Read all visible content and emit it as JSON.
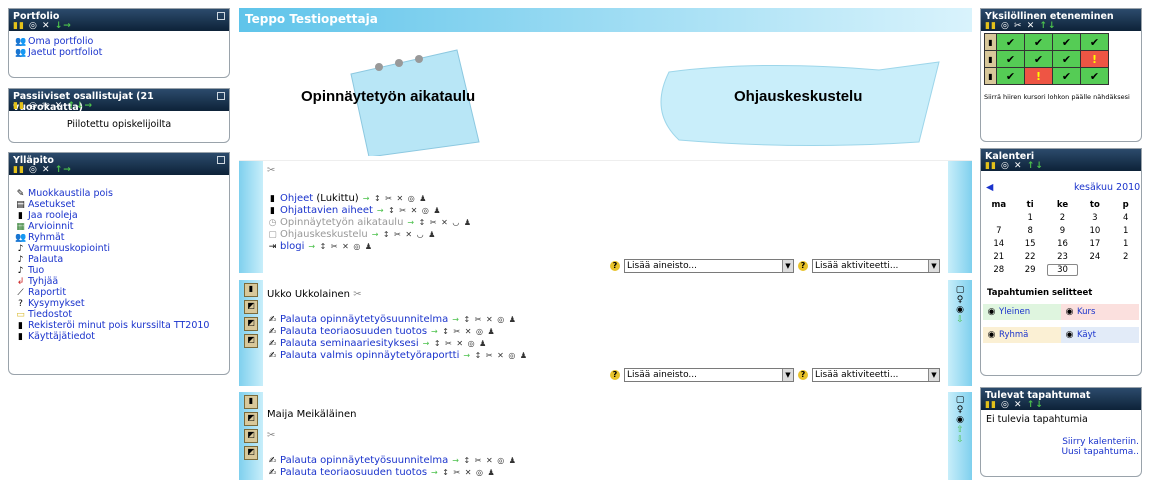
{
  "portfolio": {
    "title": "Portfolio",
    "items": [
      "Oma portfolio",
      "Jaetut portfoliot"
    ]
  },
  "passive": {
    "title": "Passiiviset osallistujat (21 vuorokautta)",
    "text": "Piilotettu opiskelijoilta"
  },
  "admin": {
    "title": "Ylläpito",
    "items": [
      "Muokkaustila pois",
      "Asetukset",
      "Jaa rooleja",
      "Arvioinnit",
      "Ryhmät",
      "Varmuuskopiointi",
      "Palauta",
      "Tuo",
      "Tyhjää",
      "Raportit",
      "Kysymykset",
      "Tiedostot",
      "Rekisteröi minut pois kurssilta TT2010",
      "Käyttäjätiedot"
    ]
  },
  "center": {
    "heading": "Teppo Testiopettaja",
    "banner_left": "Opinnäytetyön aikataulu",
    "banner_right": "Ohjauskeskustelu",
    "section0": {
      "activities": [
        {
          "label": "Ohjeet",
          "suffix": "(Lukittu)"
        },
        {
          "label": "Ohjattavien aiheet",
          "suffix": ""
        },
        {
          "label": "Opinnäytetyön aikataulu",
          "suffix": ""
        },
        {
          "label": "Ohjauskeskustelu",
          "suffix": ""
        },
        {
          "label": "blogi",
          "suffix": ""
        }
      ]
    },
    "section1": {
      "title": "Ukko Ukkolainen",
      "activities": [
        "Palauta opinnäytetyösuunnitelma",
        "Palauta teoriaosuuden tuotos",
        "Palauta seminaariesityksesi",
        "Palauta valmis opinnäytetyöraportti"
      ]
    },
    "section2": {
      "title": "Maija Meikäläinen",
      "activities": [
        "Palauta opinnäytetyösuunnitelma",
        "Palauta teoriaosuuden tuotos"
      ]
    },
    "add_resource": "Lisää aineisto...",
    "add_activity": "Lisää aktiviteetti..."
  },
  "progress": {
    "title": "Yksilöllinen eteneminen",
    "rows": [
      [
        "ok",
        "ok",
        "ok",
        "ok"
      ],
      [
        "ok",
        "ok",
        "ok",
        "warn"
      ],
      [
        "ok",
        "warn",
        "ok",
        "ok"
      ]
    ],
    "hint": "Siirrä hiiren kursori lohkon päälle nähdäksesi"
  },
  "calendar": {
    "title": "Kalenteri",
    "month": "kesäkuu 2010",
    "weekdays": [
      "ma",
      "ti",
      "ke",
      "to",
      "p"
    ],
    "weeks": [
      [
        "",
        "1",
        "2",
        "3",
        "4"
      ],
      [
        "7",
        "8",
        "9",
        "10",
        "1"
      ],
      [
        "14",
        "15",
        "16",
        "17",
        "1"
      ],
      [
        "21",
        "22",
        "23",
        "24",
        "2"
      ],
      [
        "28",
        "29",
        "30",
        "",
        ""
      ]
    ],
    "today": "30",
    "legend_title": "Tapahtumien selitteet",
    "legend": [
      "Yleinen",
      "Kurs",
      "Ryhmä",
      "Käyt"
    ]
  },
  "upcoming": {
    "title": "Tulevat tapahtumat",
    "empty": "Ei tulevia tapahtumia",
    "links": [
      "Siirry kalenteriin.",
      "Uusi tapahtuma.."
    ]
  }
}
